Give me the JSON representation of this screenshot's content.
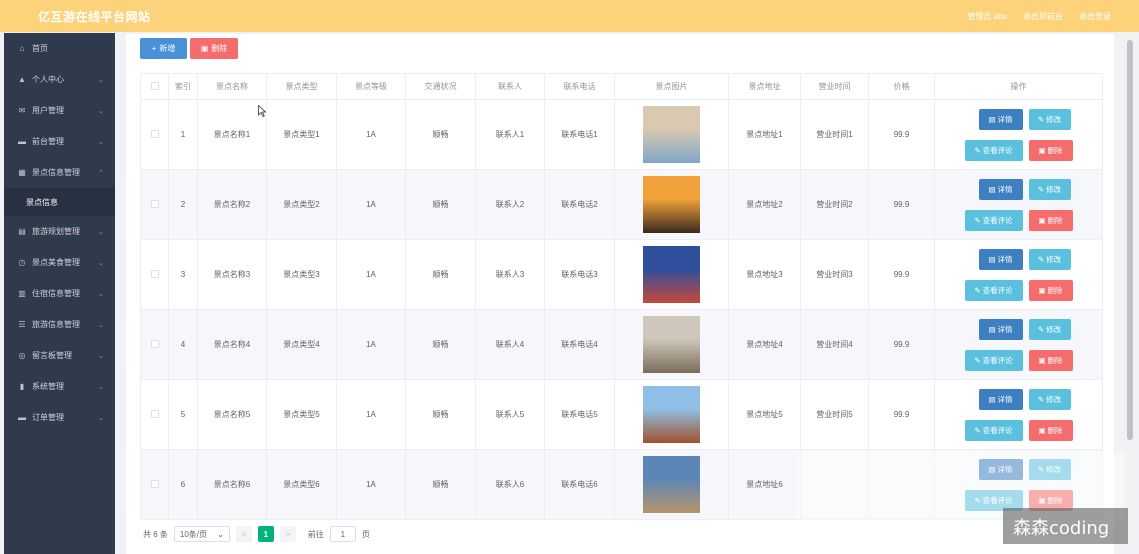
{
  "header": {
    "title": "亿互游在线平台网站",
    "admin": "管理员 abo",
    "to_frontend": "退出到前台",
    "logout": "退出登录"
  },
  "sidebar": {
    "items": [
      {
        "icon": "home-icon",
        "glyph": "⌂",
        "label": "首页",
        "arrow": ""
      },
      {
        "icon": "user-icon",
        "glyph": "▲",
        "label": "个人中心",
        "arrow": "⌄"
      },
      {
        "icon": "mail-icon",
        "glyph": "✉",
        "label": "用户管理",
        "arrow": "⌄"
      },
      {
        "icon": "monitor-icon",
        "glyph": "▬",
        "label": "前台管理",
        "arrow": "⌄"
      },
      {
        "icon": "grid-icon",
        "glyph": "▦",
        "label": "景点信息管理",
        "arrow": "⌃"
      }
    ],
    "sub_item": "景点信息",
    "items2": [
      {
        "icon": "doc-icon",
        "glyph": "▤",
        "label": "旅游规划管理",
        "arrow": "⌄"
      },
      {
        "icon": "clock-icon",
        "glyph": "◷",
        "label": "景点美食管理",
        "arrow": "⌄"
      },
      {
        "icon": "chart-icon",
        "glyph": "▥",
        "label": "住宿信息管理",
        "arrow": "⌄"
      },
      {
        "icon": "list-icon",
        "glyph": "☰",
        "label": "旅游信息管理",
        "arrow": "⌄"
      },
      {
        "icon": "message-icon",
        "glyph": "◎",
        "label": "留言板管理",
        "arrow": "⌄"
      },
      {
        "icon": "bar-icon",
        "glyph": "▮",
        "label": "系统管理",
        "arrow": "⌄"
      },
      {
        "icon": "order-icon",
        "glyph": "▬",
        "label": "订单管理",
        "arrow": "⌄"
      }
    ]
  },
  "toolbar": {
    "add_label": "新增",
    "delete_label": "删除"
  },
  "table": {
    "headers": [
      "索引",
      "景点名称",
      "景点类型",
      "景点等级",
      "交通状况",
      "联系人",
      "联系电话",
      "景点图片",
      "景点地址",
      "营业时间",
      "价格",
      "操作"
    ],
    "ops": {
      "detail": "详情",
      "edit": "修改",
      "comment": "查看评论",
      "delete": "删除"
    },
    "rows": [
      {
        "idx": "1",
        "name": "景点名称1",
        "type": "景点类型1",
        "level": "1A",
        "traffic": "顺畅",
        "contact": "联系人1",
        "phone": "联系电话1",
        "img_colors": [
          "#d9c9b0",
          "#7fa6c7"
        ],
        "address": "景点地址1",
        "hours": "营业时间1",
        "price": "99.9"
      },
      {
        "idx": "2",
        "name": "景点名称2",
        "type": "景点类型2",
        "level": "1A",
        "traffic": "顺畅",
        "contact": "联系人2",
        "phone": "联系电话2",
        "img_colors": [
          "#f2a23a",
          "#3a2a1e"
        ],
        "address": "景点地址2",
        "hours": "营业时间2",
        "price": "99.9"
      },
      {
        "idx": "3",
        "name": "景点名称3",
        "type": "景点类型3",
        "level": "1A",
        "traffic": "顺畅",
        "contact": "联系人3",
        "phone": "联系电话3",
        "img_colors": [
          "#2d4f9c",
          "#c44a3a"
        ],
        "address": "景点地址3",
        "hours": "营业时间3",
        "price": "99.9"
      },
      {
        "idx": "4",
        "name": "景点名称4",
        "type": "景点类型4",
        "level": "1A",
        "traffic": "顺畅",
        "contact": "联系人4",
        "phone": "联系电话4",
        "img_colors": [
          "#cfc7bb",
          "#7a6b5a"
        ],
        "address": "景点地址4",
        "hours": "营业时间4",
        "price": "99.9"
      },
      {
        "idx": "5",
        "name": "景点名称5",
        "type": "景点类型5",
        "level": "1A",
        "traffic": "顺畅",
        "contact": "联系人5",
        "phone": "联系电话5",
        "img_colors": [
          "#8fbfe6",
          "#a0522d"
        ],
        "address": "景点地址5",
        "hours": "营业时间5",
        "price": "99.9"
      },
      {
        "idx": "6",
        "name": "景点名称6",
        "type": "景点类型6",
        "level": "1A",
        "traffic": "顺畅",
        "contact": "联系人6",
        "phone": "联系电话6",
        "img_colors": [
          "#5b86b5",
          "#b8956b"
        ],
        "address": "景点地址6",
        "hours": "",
        "price": ""
      }
    ]
  },
  "pager": {
    "total": "共 6 条",
    "page_size": "10条/页",
    "prev": "<",
    "current": "1",
    "next": ">",
    "goto": "前往",
    "goto_value": "1",
    "page_unit": "页"
  },
  "watermark": "森森coding"
}
